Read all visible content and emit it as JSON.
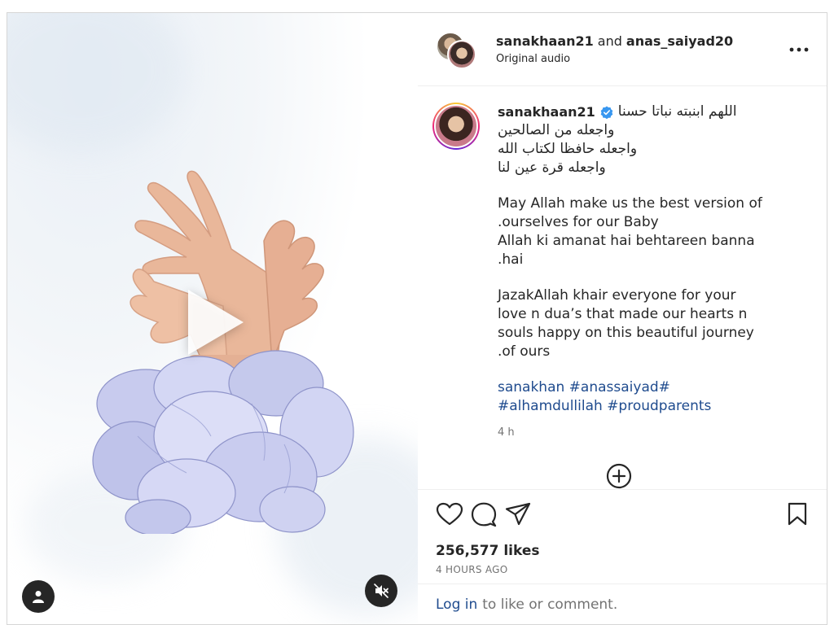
{
  "header": {
    "author": "sanakhaan21",
    "and_text": "and",
    "coauthor": "anas_saiyad20",
    "audio": "Original audio"
  },
  "caption": {
    "username": "sanakhaan21",
    "arabic": [
      "اللهم ابنبته نباتا حسنا",
      "واجعله من الصالحين",
      "واجعله حافظا لكتاب الله",
      "واجعله قرة عين لنا"
    ],
    "para1": [
      "May Allah make us the best version of",
      ".ourselves for our Baby",
      "Allah ki amanat hai behtareen banna",
      ".hai"
    ],
    "para2": [
      "JazakAllah khair everyone for your",
      "love n dua’s that made our hearts n",
      "souls happy on this beautiful journey",
      ".of ours"
    ],
    "tags": [
      "sanakhan #anassaiyad#",
      "#alhamdullilah #proudparents"
    ],
    "time": "4 h"
  },
  "engagement": {
    "likes": "256,577 likes",
    "ago": "4 HOURS AGO"
  },
  "login": {
    "link": "Log in",
    "text": "to like or comment."
  },
  "colors": {
    "link": "#1f4b8e",
    "verified": "#3897f0",
    "muted": "#737373"
  },
  "icons": [
    "play-icon",
    "user-icon",
    "mute-icon",
    "more-icon",
    "verified-icon",
    "add-comment-icon",
    "heart-icon",
    "comment-icon",
    "share-icon",
    "bookmark-icon"
  ]
}
